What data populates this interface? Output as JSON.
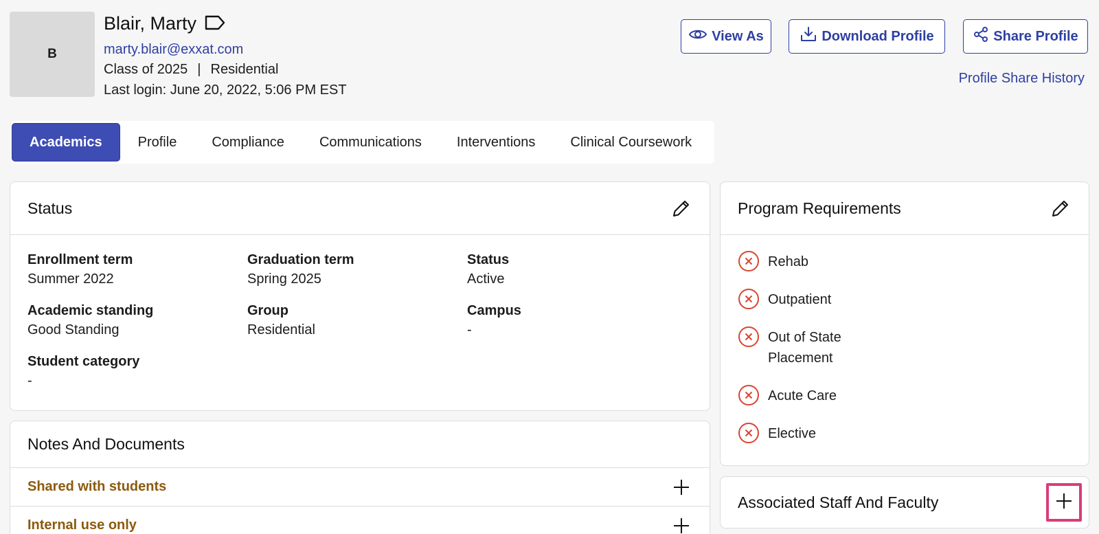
{
  "student": {
    "initial": "B",
    "name": "Blair, Marty",
    "email": "marty.blair@exxat.com",
    "class": "Class of 2025",
    "separator": "|",
    "group": "Residential",
    "last_login": "Last login: June 20, 2022, 5:06 PM EST"
  },
  "actions": {
    "view_as": "View As",
    "download_profile": "Download Profile",
    "share_profile": "Share Profile",
    "share_history": "Profile Share History"
  },
  "tabs": [
    {
      "label": "Academics",
      "active": true
    },
    {
      "label": "Profile",
      "active": false
    },
    {
      "label": "Compliance",
      "active": false
    },
    {
      "label": "Communications",
      "active": false
    },
    {
      "label": "Interventions",
      "active": false
    },
    {
      "label": "Clinical Coursework",
      "active": false
    }
  ],
  "status_card": {
    "title": "Status",
    "fields": [
      {
        "label": "Enrollment term",
        "value": "Summer 2022"
      },
      {
        "label": "Graduation term",
        "value": "Spring 2025"
      },
      {
        "label": "Status",
        "value": "Active"
      },
      {
        "label": "Academic standing",
        "value": "Good Standing"
      },
      {
        "label": "Group",
        "value": "Residential"
      },
      {
        "label": "Campus",
        "value": "-"
      },
      {
        "label": "Student category",
        "value": "-"
      }
    ]
  },
  "notes_card": {
    "title": "Notes And Documents",
    "rows": [
      {
        "label": "Shared with students"
      },
      {
        "label": "Internal use only"
      }
    ]
  },
  "requirements_card": {
    "title": "Program Requirements",
    "items": [
      {
        "label": "Rehab",
        "met": false
      },
      {
        "label": "Outpatient",
        "met": false
      },
      {
        "label": "Out of State Placement",
        "met": false
      },
      {
        "label": "Acute Care",
        "met": false
      },
      {
        "label": "Elective",
        "met": false
      }
    ]
  },
  "staff_card": {
    "title": "Associated Staff And Faculty"
  },
  "colors": {
    "accent": "#2e3fa3",
    "active_tab": "#3e4db3",
    "notes_label": "#8c5a0d",
    "unmet_icon": "#d9452f",
    "highlight": "#d83d7a"
  }
}
